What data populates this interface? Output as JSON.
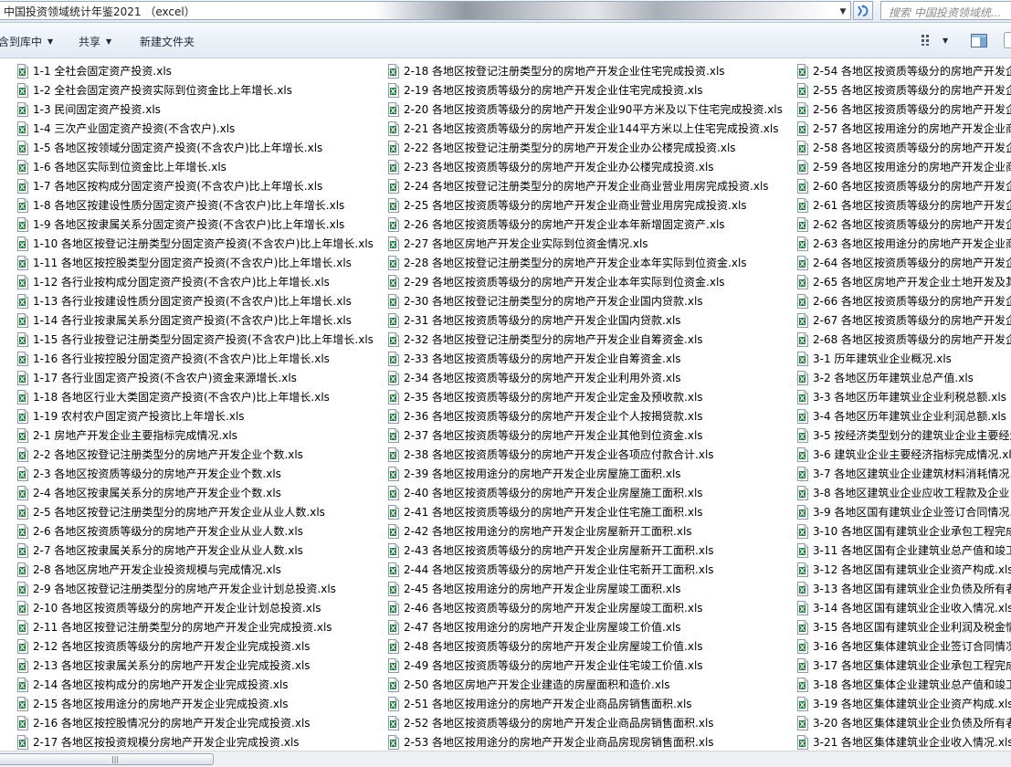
{
  "address_bar": {
    "path": "中国投资领域统计年鉴2021 （excel）",
    "search_placeholder": "搜索 中国投资领域统..."
  },
  "toolbar": {
    "include_library": "含到库中",
    "share": "共享",
    "new_folder": "新建文件夹"
  },
  "files": {
    "column1": [
      "1-1 全社会固定资产投资.xls",
      "1-2 全社会固定资产投资实际到位资金比上年增长.xls",
      "1-3 民间固定资产投资.xls",
      "1-4 三次产业固定资产投资(不含农户).xls",
      "1-5 各地区按领域分固定资产投资(不含农户)比上年增长.xls",
      "1-6 各地区实际到位资金比上年增长.xls",
      "1-7 各地区按构成分固定资产投资(不含农户)比上年增长.xls",
      "1-8 各地区按建设性质分固定资产投资(不含农户)比上年增长.xls",
      "1-9 各地区按隶属关系分固定资产投资(不含农户)比上年增长.xls",
      "1-10 各地区按登记注册类型分固定资产投资(不含农户)比上年增长.xls",
      "1-11 各地区按控股类型分固定资产投资(不含农户)比上年增长.xls",
      "1-12 各行业按构成分固定资产投资(不含农户)比上年增长.xls",
      "1-13 各行业按建设性质分固定资产投资(不含农户)比上年增长.xls",
      "1-14 各行业按隶属关系分固定资产投资(不含农户)比上年增长.xls",
      "1-15 各行业按登记注册类型分固定资产投资(不含农户)比上年增长.xls",
      "1-16 各行业按控股分固定资产投资(不含农户)比上年增长.xls",
      "1-17 各行业固定资产投资(不含农户)资金来源增长.xls",
      "1-18 各地区行业大类固定资产投资(不含农户)比上年增长.xls",
      "1-19 农村农户固定资产投资比上年增长.xls",
      "2-1 房地产开发企业主要指标完成情况.xls",
      "2-2 各地区按登记注册类型分的房地产开发企业个数.xls",
      "2-3 各地区按资质等级分的房地产开发企业个数.xls",
      "2-4 各地区按隶属关系分的房地产开发企业个数.xls",
      "2-5 各地区按登记注册类型分的房地产开发企业从业人数.xls",
      "2-6 各地区按资质等级分的房地产开发企业从业人数.xls",
      "2-7 各地区按隶属关系分的房地产开发企业从业人数.xls",
      "2-8 各地区房地产开发企业投资规模与完成情况.xls",
      "2-9 各地区按登记注册类型分的房地产开发企业计划总投资.xls",
      "2-10 各地区按资质等级分的房地产开发企业计划总投资.xls",
      "2-11 各地区按登记注册类型分的房地产开发企业完成投资.xls",
      "2-12 各地区按资质等级分的房地产开发企业完成投资.xls",
      "2-13 各地区按隶属关系分的房地产开发企业完成投资.xls",
      "2-14 各地区按构成分的房地产开发企业完成投资.xls",
      "2-15 各地区按用途分的房地产开发企业完成投资.xls",
      "2-16 各地区按控股情况分的房地产开发企业完成投资.xls",
      "2-17 各地区按投资规模分房地产开发企业完成投资.xls"
    ],
    "column2": [
      "2-18 各地区按登记注册类型分的房地产开发企业住宅完成投资.xls",
      "2-19 各地区按资质等级分的房地产开发企业住宅完成投资.xls",
      "2-20 各地区按资质等级分的房地产开发企业90平方米及以下住宅完成投资.xls",
      "2-21 各地区按资质等级分的房地产开发企业144平方米以上住宅完成投资.xls",
      "2-22 各地区按登记注册类型分的房地产开发企业办公楼完成投资.xls",
      "2-23 各地区按资质等级分的房地产开发企业办公楼完成投资.xls",
      "2-24 各地区按登记注册类型分的房地产开发企业商业营业用房完成投资.xls",
      "2-25 各地区按资质等级分的房地产开发企业商业营业用房完成投资.xls",
      "2-26 各地区按资质等级分的房地产开发企业本年新增固定资产.xls",
      "2-27 各地区房地产开发企业实际到位资金情况.xls",
      "2-28 各地区按登记注册类型分的房地产开发企业本年实际到位资金.xls",
      "2-29 各地区按资质等级分的房地产开发企业本年实际到位资金.xls",
      "2-30 各地区按登记注册类型分的房地产开发企业国内贷款.xls",
      "2-31 各地区按资质等级分的房地产开发企业国内贷款.xls",
      "2-32 各地区按登记注册类型分的房地产开发企业自筹资金.xls",
      "2-33 各地区按资质等级分的房地产开发企业自筹资金.xls",
      "2-34 各地区按资质等级分的房地产开发企业利用外资.xls",
      "2-35 各地区按资质等级分的房地产开发企业定金及预收款.xls",
      "2-36 各地区按资质等级分的房地产开发企业个人按揭贷款.xls",
      "2-37 各地区按资质等级分的房地产开发企业其他到位资金.xls",
      "2-38 各地区按资质等级分的房地产开发企业各项应付款合计.xls",
      "2-39 各地区按用途分的房地产开发企业房屋施工面积.xls",
      "2-40 各地区按资质等级分的房地产开发企业房屋施工面积.xls",
      "2-41 各地区按资质等级分的房地产开发企业住宅施工面积.xls",
      "2-42 各地区按用途分的房地产开发企业房屋新开工面积.xls",
      "2-43 各地区按资质等级分的房地产开发企业房屋新开工面积.xls",
      "2-44 各地区按资质等级分的房地产开发企业住宅新开工面积.xls",
      "2-45 各地区按用途分的房地产开发企业房屋竣工面积.xls",
      "2-46 各地区按资质等级分的房地产开发企业房屋竣工面积.xls",
      "2-47 各地区按用途分的房地产开发企业房屋竣工价值.xls",
      "2-48 各地区按资质等级分的房地产开发企业房屋竣工价值.xls",
      "2-49 各地区按资质等级分的房地产开发企业住宅竣工价值.xls",
      "2-50 各地区房地产开发企业建造的房屋面积和造价.xls",
      "2-51 各地区按用途分的房地产开发企业商品房销售面积.xls",
      "2-52 各地区按资质等级分的房地产开发企业商品房销售面积.xls",
      "2-53 各地区按用途分的房地产开发企业商品房现房销售面积.xls"
    ],
    "column3": [
      "2-54 各地区按资质等级分的房地产开发企",
      "2-55 各地区按资质等级分的房地产开发企",
      "2-56 各地区按资质等级分的房地产开发企",
      "2-57 各地区按用途分的房地产开发企业商",
      "2-58 各地区按资质等级分的房地产开发企",
      "2-59 各地区按用途分的房地产开发企业商",
      "2-60 各地区按资质等级分的房地产开发企",
      "2-61 各地区按资质等级分的房地产开发企",
      "2-62 各地区按资质等级分的房地产开发企",
      "2-63 各地区按用途分的房地产开发企业商",
      "2-64 各地区按资质等级分的房地产开发企",
      "2-65 各地区房地产开发企业土地开发及其",
      "2-66 各地区按资质等级分的房地产开发企",
      "2-67 各地区按资质等级分的房地产开发企",
      "2-68 各地区按资质等级分的房地产开发企",
      "3-1 历年建筑业企业概况.xls",
      "3-2 各地区历年建筑业总产值.xls",
      "3-3 各地区历年建筑业企业利税总额.xls",
      "3-4 各地区历年建筑业企业利润总额.xls",
      "3-5 按经济类型划分的建筑业企业主要经济",
      "3-6 建筑业企业主要经济指标完成情况.xls",
      "3-7 各地区建筑业企业建筑材料消耗情况.",
      "3-8 各地区建筑业企业应收工程款及企业",
      "3-9 各地区国有建筑业企业签订合同情况.",
      "3-10 各地区国有建筑业企业承包工程完成",
      "3-11 各地区国有企业建筑业总产值和竣工",
      "3-12 各地区国有建筑业企业资产构成.xls",
      "3-13 各地区国有建筑业企业负债及所有者",
      "3-14 各地区国有建筑业企业收入情况.xls",
      "3-15 各地区国有建筑业企业利润及税金情",
      "3-16 各地区集体建筑业企业签订合同情况",
      "3-17 各地区集体建筑业企业承包工程完成",
      "3-18 各地区集体企业建筑业总产值和竣工",
      "3-19 各地区集体建筑业企业资产构成.xls",
      "3-20 各地区集体建筑业企业负债及所有者",
      "3-21 各地区集体建筑业企业收入情况.xls"
    ]
  },
  "colors": {
    "xls_icon_green": "#1f7a3c",
    "toolbar_text": "#1e2b3c",
    "search_placeholder_gray": "#8a8a8a"
  }
}
